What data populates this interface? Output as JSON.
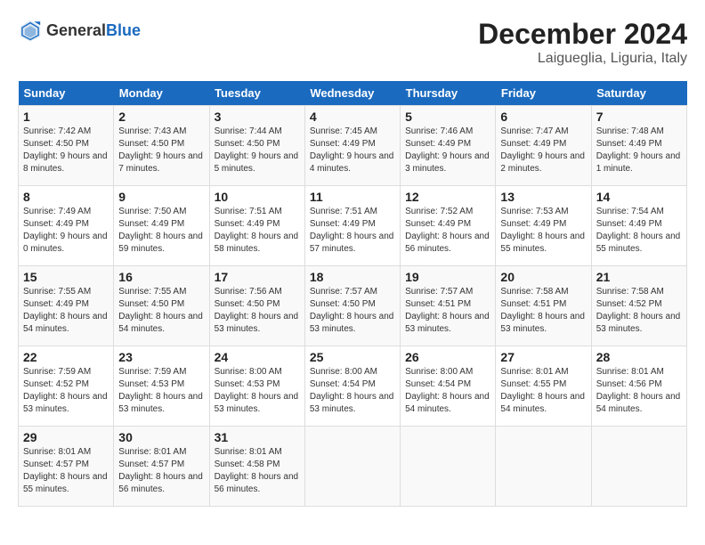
{
  "header": {
    "logo_general": "General",
    "logo_blue": "Blue",
    "month": "December 2024",
    "location": "Laigueglia, Liguria, Italy"
  },
  "days_of_week": [
    "Sunday",
    "Monday",
    "Tuesday",
    "Wednesday",
    "Thursday",
    "Friday",
    "Saturday"
  ],
  "weeks": [
    [
      {
        "day": "1",
        "sunrise": "Sunrise: 7:42 AM",
        "sunset": "Sunset: 4:50 PM",
        "daylight": "Daylight: 9 hours and 8 minutes."
      },
      {
        "day": "2",
        "sunrise": "Sunrise: 7:43 AM",
        "sunset": "Sunset: 4:50 PM",
        "daylight": "Daylight: 9 hours and 7 minutes."
      },
      {
        "day": "3",
        "sunrise": "Sunrise: 7:44 AM",
        "sunset": "Sunset: 4:50 PM",
        "daylight": "Daylight: 9 hours and 5 minutes."
      },
      {
        "day": "4",
        "sunrise": "Sunrise: 7:45 AM",
        "sunset": "Sunset: 4:49 PM",
        "daylight": "Daylight: 9 hours and 4 minutes."
      },
      {
        "day": "5",
        "sunrise": "Sunrise: 7:46 AM",
        "sunset": "Sunset: 4:49 PM",
        "daylight": "Daylight: 9 hours and 3 minutes."
      },
      {
        "day": "6",
        "sunrise": "Sunrise: 7:47 AM",
        "sunset": "Sunset: 4:49 PM",
        "daylight": "Daylight: 9 hours and 2 minutes."
      },
      {
        "day": "7",
        "sunrise": "Sunrise: 7:48 AM",
        "sunset": "Sunset: 4:49 PM",
        "daylight": "Daylight: 9 hours and 1 minute."
      }
    ],
    [
      {
        "day": "8",
        "sunrise": "Sunrise: 7:49 AM",
        "sunset": "Sunset: 4:49 PM",
        "daylight": "Daylight: 9 hours and 0 minutes."
      },
      {
        "day": "9",
        "sunrise": "Sunrise: 7:50 AM",
        "sunset": "Sunset: 4:49 PM",
        "daylight": "Daylight: 8 hours and 59 minutes."
      },
      {
        "day": "10",
        "sunrise": "Sunrise: 7:51 AM",
        "sunset": "Sunset: 4:49 PM",
        "daylight": "Daylight: 8 hours and 58 minutes."
      },
      {
        "day": "11",
        "sunrise": "Sunrise: 7:51 AM",
        "sunset": "Sunset: 4:49 PM",
        "daylight": "Daylight: 8 hours and 57 minutes."
      },
      {
        "day": "12",
        "sunrise": "Sunrise: 7:52 AM",
        "sunset": "Sunset: 4:49 PM",
        "daylight": "Daylight: 8 hours and 56 minutes."
      },
      {
        "day": "13",
        "sunrise": "Sunrise: 7:53 AM",
        "sunset": "Sunset: 4:49 PM",
        "daylight": "Daylight: 8 hours and 55 minutes."
      },
      {
        "day": "14",
        "sunrise": "Sunrise: 7:54 AM",
        "sunset": "Sunset: 4:49 PM",
        "daylight": "Daylight: 8 hours and 55 minutes."
      }
    ],
    [
      {
        "day": "15",
        "sunrise": "Sunrise: 7:55 AM",
        "sunset": "Sunset: 4:49 PM",
        "daylight": "Daylight: 8 hours and 54 minutes."
      },
      {
        "day": "16",
        "sunrise": "Sunrise: 7:55 AM",
        "sunset": "Sunset: 4:50 PM",
        "daylight": "Daylight: 8 hours and 54 minutes."
      },
      {
        "day": "17",
        "sunrise": "Sunrise: 7:56 AM",
        "sunset": "Sunset: 4:50 PM",
        "daylight": "Daylight: 8 hours and 53 minutes."
      },
      {
        "day": "18",
        "sunrise": "Sunrise: 7:57 AM",
        "sunset": "Sunset: 4:50 PM",
        "daylight": "Daylight: 8 hours and 53 minutes."
      },
      {
        "day": "19",
        "sunrise": "Sunrise: 7:57 AM",
        "sunset": "Sunset: 4:51 PM",
        "daylight": "Daylight: 8 hours and 53 minutes."
      },
      {
        "day": "20",
        "sunrise": "Sunrise: 7:58 AM",
        "sunset": "Sunset: 4:51 PM",
        "daylight": "Daylight: 8 hours and 53 minutes."
      },
      {
        "day": "21",
        "sunrise": "Sunrise: 7:58 AM",
        "sunset": "Sunset: 4:52 PM",
        "daylight": "Daylight: 8 hours and 53 minutes."
      }
    ],
    [
      {
        "day": "22",
        "sunrise": "Sunrise: 7:59 AM",
        "sunset": "Sunset: 4:52 PM",
        "daylight": "Daylight: 8 hours and 53 minutes."
      },
      {
        "day": "23",
        "sunrise": "Sunrise: 7:59 AM",
        "sunset": "Sunset: 4:53 PM",
        "daylight": "Daylight: 8 hours and 53 minutes."
      },
      {
        "day": "24",
        "sunrise": "Sunrise: 8:00 AM",
        "sunset": "Sunset: 4:53 PM",
        "daylight": "Daylight: 8 hours and 53 minutes."
      },
      {
        "day": "25",
        "sunrise": "Sunrise: 8:00 AM",
        "sunset": "Sunset: 4:54 PM",
        "daylight": "Daylight: 8 hours and 53 minutes."
      },
      {
        "day": "26",
        "sunrise": "Sunrise: 8:00 AM",
        "sunset": "Sunset: 4:54 PM",
        "daylight": "Daylight: 8 hours and 54 minutes."
      },
      {
        "day": "27",
        "sunrise": "Sunrise: 8:01 AM",
        "sunset": "Sunset: 4:55 PM",
        "daylight": "Daylight: 8 hours and 54 minutes."
      },
      {
        "day": "28",
        "sunrise": "Sunrise: 8:01 AM",
        "sunset": "Sunset: 4:56 PM",
        "daylight": "Daylight: 8 hours and 54 minutes."
      }
    ],
    [
      {
        "day": "29",
        "sunrise": "Sunrise: 8:01 AM",
        "sunset": "Sunset: 4:57 PM",
        "daylight": "Daylight: 8 hours and 55 minutes."
      },
      {
        "day": "30",
        "sunrise": "Sunrise: 8:01 AM",
        "sunset": "Sunset: 4:57 PM",
        "daylight": "Daylight: 8 hours and 56 minutes."
      },
      {
        "day": "31",
        "sunrise": "Sunrise: 8:01 AM",
        "sunset": "Sunset: 4:58 PM",
        "daylight": "Daylight: 8 hours and 56 minutes."
      },
      null,
      null,
      null,
      null
    ]
  ]
}
